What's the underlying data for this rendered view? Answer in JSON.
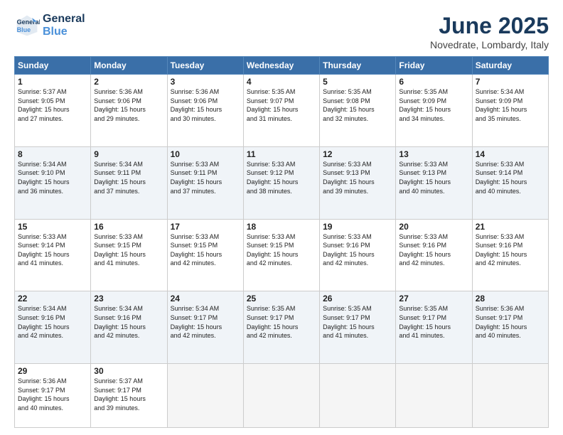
{
  "header": {
    "logo_line1": "General",
    "logo_line2": "Blue",
    "month": "June 2025",
    "location": "Novedrate, Lombardy, Italy"
  },
  "weekdays": [
    "Sunday",
    "Monday",
    "Tuesday",
    "Wednesday",
    "Thursday",
    "Friday",
    "Saturday"
  ],
  "weeks": [
    [
      {
        "day": "1",
        "info": "Sunrise: 5:37 AM\nSunset: 9:05 PM\nDaylight: 15 hours\nand 27 minutes."
      },
      {
        "day": "2",
        "info": "Sunrise: 5:36 AM\nSunset: 9:06 PM\nDaylight: 15 hours\nand 29 minutes."
      },
      {
        "day": "3",
        "info": "Sunrise: 5:36 AM\nSunset: 9:06 PM\nDaylight: 15 hours\nand 30 minutes."
      },
      {
        "day": "4",
        "info": "Sunrise: 5:35 AM\nSunset: 9:07 PM\nDaylight: 15 hours\nand 31 minutes."
      },
      {
        "day": "5",
        "info": "Sunrise: 5:35 AM\nSunset: 9:08 PM\nDaylight: 15 hours\nand 32 minutes."
      },
      {
        "day": "6",
        "info": "Sunrise: 5:35 AM\nSunset: 9:09 PM\nDaylight: 15 hours\nand 34 minutes."
      },
      {
        "day": "7",
        "info": "Sunrise: 5:34 AM\nSunset: 9:09 PM\nDaylight: 15 hours\nand 35 minutes."
      }
    ],
    [
      {
        "day": "8",
        "info": "Sunrise: 5:34 AM\nSunset: 9:10 PM\nDaylight: 15 hours\nand 36 minutes."
      },
      {
        "day": "9",
        "info": "Sunrise: 5:34 AM\nSunset: 9:11 PM\nDaylight: 15 hours\nand 37 minutes."
      },
      {
        "day": "10",
        "info": "Sunrise: 5:33 AM\nSunset: 9:11 PM\nDaylight: 15 hours\nand 37 minutes."
      },
      {
        "day": "11",
        "info": "Sunrise: 5:33 AM\nSunset: 9:12 PM\nDaylight: 15 hours\nand 38 minutes."
      },
      {
        "day": "12",
        "info": "Sunrise: 5:33 AM\nSunset: 9:13 PM\nDaylight: 15 hours\nand 39 minutes."
      },
      {
        "day": "13",
        "info": "Sunrise: 5:33 AM\nSunset: 9:13 PM\nDaylight: 15 hours\nand 40 minutes."
      },
      {
        "day": "14",
        "info": "Sunrise: 5:33 AM\nSunset: 9:14 PM\nDaylight: 15 hours\nand 40 minutes."
      }
    ],
    [
      {
        "day": "15",
        "info": "Sunrise: 5:33 AM\nSunset: 9:14 PM\nDaylight: 15 hours\nand 41 minutes."
      },
      {
        "day": "16",
        "info": "Sunrise: 5:33 AM\nSunset: 9:15 PM\nDaylight: 15 hours\nand 41 minutes."
      },
      {
        "day": "17",
        "info": "Sunrise: 5:33 AM\nSunset: 9:15 PM\nDaylight: 15 hours\nand 42 minutes."
      },
      {
        "day": "18",
        "info": "Sunrise: 5:33 AM\nSunset: 9:15 PM\nDaylight: 15 hours\nand 42 minutes."
      },
      {
        "day": "19",
        "info": "Sunrise: 5:33 AM\nSunset: 9:16 PM\nDaylight: 15 hours\nand 42 minutes."
      },
      {
        "day": "20",
        "info": "Sunrise: 5:33 AM\nSunset: 9:16 PM\nDaylight: 15 hours\nand 42 minutes."
      },
      {
        "day": "21",
        "info": "Sunrise: 5:33 AM\nSunset: 9:16 PM\nDaylight: 15 hours\nand 42 minutes."
      }
    ],
    [
      {
        "day": "22",
        "info": "Sunrise: 5:34 AM\nSunset: 9:16 PM\nDaylight: 15 hours\nand 42 minutes."
      },
      {
        "day": "23",
        "info": "Sunrise: 5:34 AM\nSunset: 9:16 PM\nDaylight: 15 hours\nand 42 minutes."
      },
      {
        "day": "24",
        "info": "Sunrise: 5:34 AM\nSunset: 9:17 PM\nDaylight: 15 hours\nand 42 minutes."
      },
      {
        "day": "25",
        "info": "Sunrise: 5:35 AM\nSunset: 9:17 PM\nDaylight: 15 hours\nand 42 minutes."
      },
      {
        "day": "26",
        "info": "Sunrise: 5:35 AM\nSunset: 9:17 PM\nDaylight: 15 hours\nand 41 minutes."
      },
      {
        "day": "27",
        "info": "Sunrise: 5:35 AM\nSunset: 9:17 PM\nDaylight: 15 hours\nand 41 minutes."
      },
      {
        "day": "28",
        "info": "Sunrise: 5:36 AM\nSunset: 9:17 PM\nDaylight: 15 hours\nand 40 minutes."
      }
    ],
    [
      {
        "day": "29",
        "info": "Sunrise: 5:36 AM\nSunset: 9:17 PM\nDaylight: 15 hours\nand 40 minutes."
      },
      {
        "day": "30",
        "info": "Sunrise: 5:37 AM\nSunset: 9:17 PM\nDaylight: 15 hours\nand 39 minutes."
      },
      {
        "day": "",
        "info": ""
      },
      {
        "day": "",
        "info": ""
      },
      {
        "day": "",
        "info": ""
      },
      {
        "day": "",
        "info": ""
      },
      {
        "day": "",
        "info": ""
      }
    ]
  ]
}
